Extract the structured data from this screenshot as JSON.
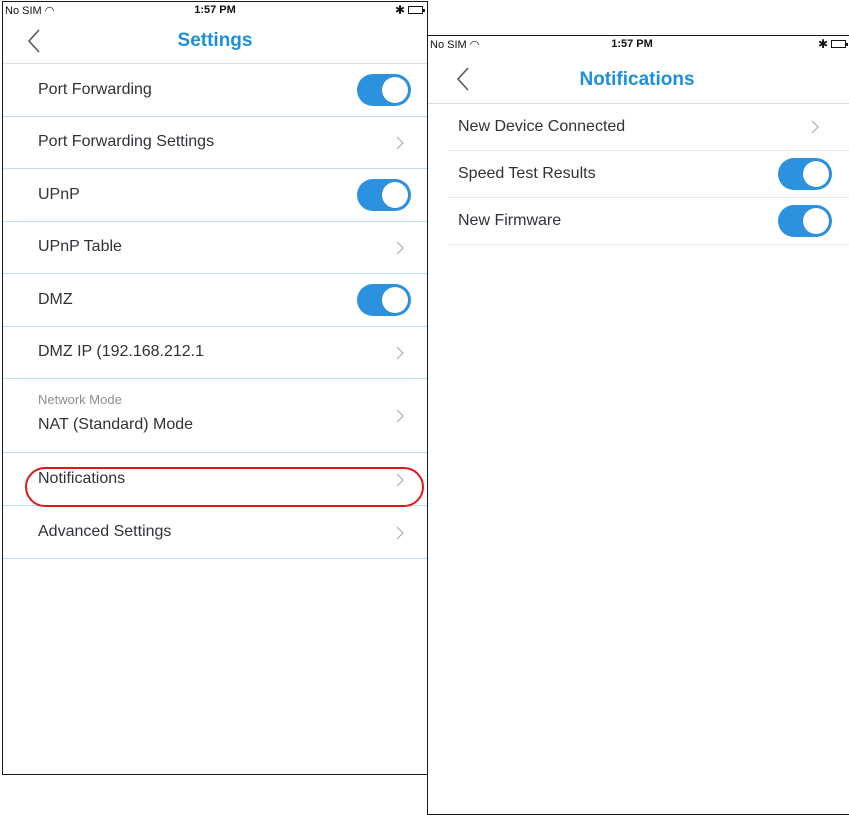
{
  "status_bar": {
    "carrier": "No SIM",
    "time": "1:57 PM",
    "wifi_icon": "wifi-icon",
    "bluetooth_icon": "bluetooth-icon",
    "battery_icon": "battery-icon"
  },
  "settings_screen": {
    "title": "Settings",
    "rows": [
      {
        "label": "Port Forwarding",
        "control": "toggle",
        "on": true
      },
      {
        "label": "Port Forwarding Settings",
        "control": "chevron"
      },
      {
        "label": "UPnP",
        "control": "toggle",
        "on": true
      },
      {
        "label": "UPnP Table",
        "control": "chevron"
      },
      {
        "label": "DMZ",
        "control": "toggle",
        "on": true
      },
      {
        "label": "DMZ IP (192.168.212.1",
        "control": "chevron"
      },
      {
        "sublabel": "Network Mode",
        "label": "NAT (Standard) Mode",
        "control": "chevron"
      },
      {
        "label": "Notifications",
        "control": "chevron",
        "highlighted": true
      },
      {
        "label": "Advanced Settings",
        "control": "chevron"
      }
    ]
  },
  "notifications_screen": {
    "title": "Notifications",
    "rows": [
      {
        "label": "New Device Connected",
        "control": "chevron"
      },
      {
        "label": "Speed Test Results",
        "control": "toggle",
        "on": true
      },
      {
        "label": "New Firmware",
        "control": "toggle",
        "on": true
      }
    ]
  },
  "colors": {
    "accent": "#2c91df",
    "title": "#1d8fdc",
    "divider": "#b9dcef",
    "highlight": "#e0171b"
  }
}
